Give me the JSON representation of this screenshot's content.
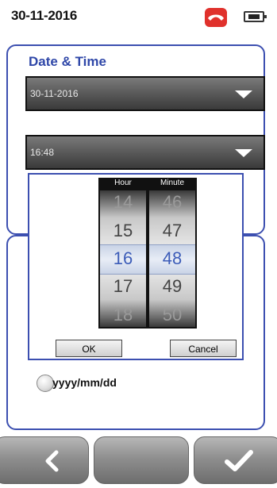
{
  "status_bar": {
    "date": "30-11-2016",
    "phone_icon": "hang-up-phone-icon",
    "battery_icon": "battery-icon"
  },
  "settings": {
    "title": "Date & Time",
    "date_dropdown_value": "30-11-2016",
    "time_dropdown_value": "16:48"
  },
  "time_picker": {
    "hour_header": "Hour",
    "minute_header": "Minute",
    "hours": [
      "14",
      "15",
      "16",
      "17",
      "18"
    ],
    "minutes": [
      "46",
      "47",
      "48",
      "49",
      "50"
    ],
    "selected_hour": "16",
    "selected_minute": "48",
    "ok_label": "OK",
    "cancel_label": "Cancel"
  },
  "format_option": {
    "label": "yyyy/mm/dd"
  },
  "nav": {
    "back_icon": "chevron-left-icon",
    "confirm_icon": "checkmark-icon"
  },
  "colors": {
    "accent": "#3c4fb0",
    "title": "#2f47a8",
    "phone_red": "#e0312c",
    "selected_value": "#3c5cb8"
  }
}
